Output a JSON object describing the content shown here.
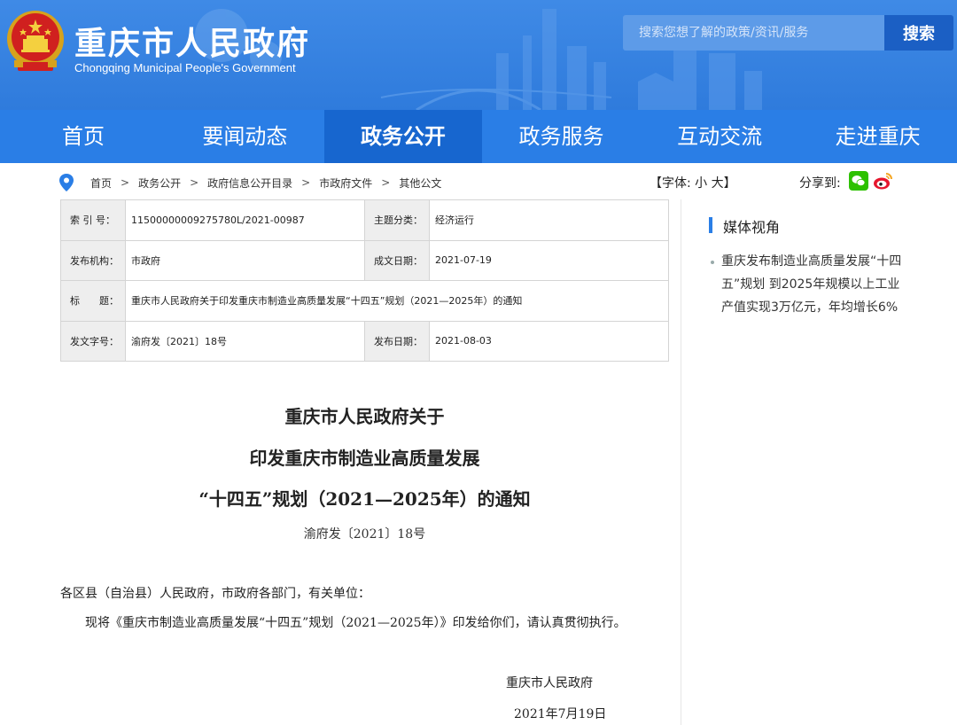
{
  "header": {
    "title": "重庆市人民政府",
    "subtitle": "Chongqing Municipal People's Government",
    "search_placeholder": "搜索您想了解的政策/资讯/服务",
    "search_button": "搜索"
  },
  "nav": {
    "items": [
      {
        "label": "首页"
      },
      {
        "label": "要闻动态"
      },
      {
        "label": "政务公开",
        "active": true
      },
      {
        "label": "政务服务"
      },
      {
        "label": "互动交流"
      },
      {
        "label": "走进重庆"
      }
    ]
  },
  "breadcrumb": [
    "首页",
    "政务公开",
    "政府信息公开目录",
    "市政府文件",
    "其他公文"
  ],
  "breadcrumb_sep": ">",
  "font_size": "【字体: 小 大】",
  "share_label": "分享到:",
  "info": {
    "index_label": "索 引 号：",
    "index_value": "11500000009275780L/2021-00987",
    "category_label": "主题分类：",
    "category_value": "经济运行",
    "publisher_label": "发布机构：",
    "publisher_value": "市政府",
    "written_label": "成文日期：",
    "written_value": "2021-07-19",
    "title_label": "标　　题：",
    "title_value": "重庆市人民政府关于印发重庆市制造业高质量发展“十四五”规划（2021—2025年）的通知",
    "docno_label": "发文字号：",
    "docno_value": "渝府发〔2021〕18号",
    "published_label": "发布日期：",
    "published_value": "2021-08-03"
  },
  "sidebar": {
    "title": "媒体视角",
    "news": "重庆发布制造业高质量发展“十四五”规划 到2025年规模以上工业产值实现3万亿元，年均增长6%"
  },
  "document": {
    "title_line1": "重庆市人民政府关于",
    "title_line2": "印发重庆市制造业高质量发展",
    "title_line3": "“十四五”规划（2021—2025年）的通知",
    "doc_number": "渝府发〔2021〕18号",
    "salutation": "各区县（自治县）人民政府，市政府各部门，有关单位：",
    "body": "现将《重庆市制造业高质量发展“十四五”规划（2021—2025年）》印发给你们，请认真贯彻执行。",
    "signer": "重庆市人民政府",
    "date": "2021年7月19日"
  },
  "colors": {
    "header_blue": "#3f8ae6",
    "nav_blue": "#2a7ee6",
    "nav_active": "#1766cf",
    "search_button": "#1b5fc4"
  }
}
